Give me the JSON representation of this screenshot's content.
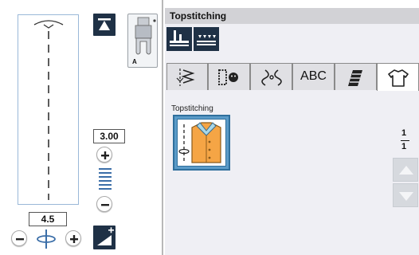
{
  "stitch_preview": {
    "stitch_width": "4.5",
    "stitch_length": "3.00"
  },
  "presser_foot": {
    "label": "A"
  },
  "panel": {
    "title": "Topstitching",
    "category_label": "Topstitching"
  },
  "tabs": [
    {
      "id": "utility",
      "label": ""
    },
    {
      "id": "buttonhole",
      "label": ""
    },
    {
      "id": "decorative",
      "label": ""
    },
    {
      "id": "alphabet",
      "label": "ABC"
    },
    {
      "id": "quilt",
      "label": ""
    },
    {
      "id": "garment",
      "label": "",
      "selected": true
    }
  ],
  "pagination": {
    "current": "1",
    "total": "1"
  },
  "colors": {
    "dark_button": "#1f3146",
    "accent_blue": "#5b9bc8",
    "panel_bg": "#efeff4"
  }
}
